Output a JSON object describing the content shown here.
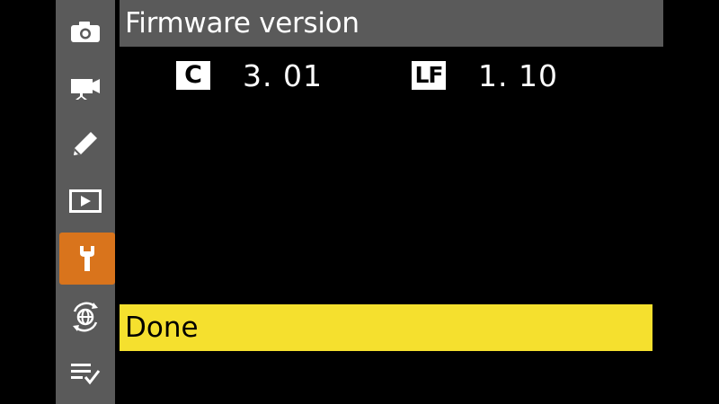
{
  "header": {
    "title": "Firmware version"
  },
  "firmware": {
    "camera": {
      "badge": "C",
      "version": "3. 01"
    },
    "lens": {
      "badge": "LF",
      "version": "1. 10"
    }
  },
  "sidebar": {
    "items": [
      {
        "icon": "camera-icon",
        "active": false
      },
      {
        "icon": "movie-camera-icon",
        "active": false
      },
      {
        "icon": "pencil-icon",
        "active": false
      },
      {
        "icon": "playback-icon",
        "active": false
      },
      {
        "icon": "wrench-icon",
        "active": true
      },
      {
        "icon": "network-icon",
        "active": false
      },
      {
        "icon": "my-menu-icon",
        "active": false
      }
    ]
  },
  "actions": {
    "done_label": "Done"
  },
  "colors": {
    "highlight": "#f5e02e",
    "active_tab": "#d9741c",
    "panel": "#5a5a5a",
    "background": "#000000"
  }
}
